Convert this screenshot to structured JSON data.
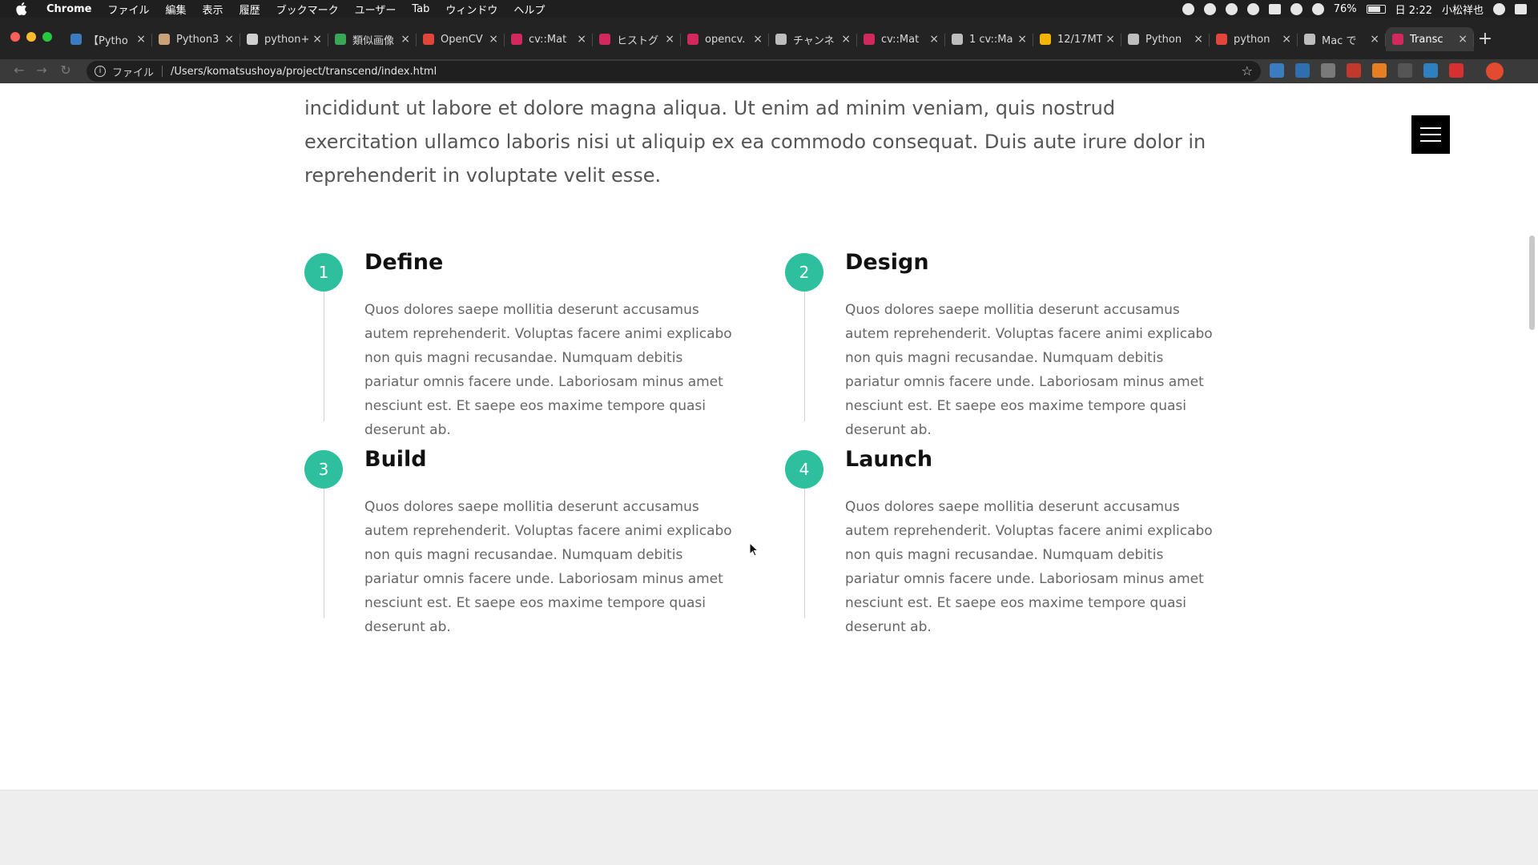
{
  "menubar": {
    "app": "Chrome",
    "items": [
      "ファイル",
      "編集",
      "表示",
      "履歴",
      "ブックマーク",
      "ユーザー",
      "Tab",
      "ウィンドウ",
      "ヘルプ"
    ],
    "battery": "76%",
    "battery_level": 0.76,
    "clock": "日 2:22",
    "user": "小松祥也"
  },
  "browser": {
    "tabs": [
      {
        "label": "【Pytho",
        "favicon_color": "#3b7bbf"
      },
      {
        "label": "Python3",
        "favicon_color": "#c9a27a"
      },
      {
        "label": "python+",
        "favicon_color": "#d0d0d0"
      },
      {
        "label": "類似画像",
        "favicon_color": "#3aa757"
      },
      {
        "label": "OpenCV",
        "favicon_color": "#e0463a"
      },
      {
        "label": "cv::Mat",
        "favicon_color": "#d1295b"
      },
      {
        "label": "ヒストグ",
        "favicon_color": "#d1295b"
      },
      {
        "label": "opencv.",
        "favicon_color": "#d1295b"
      },
      {
        "label": "チャンネ",
        "favicon_color": "#bdbdbd"
      },
      {
        "label": "cv::Mat",
        "favicon_color": "#d1295b"
      },
      {
        "label": "1 cv::Ma",
        "favicon_color": "#bdbdbd"
      },
      {
        "label": "12/17MT",
        "favicon_color": "#f2b400"
      },
      {
        "label": "Python",
        "favicon_color": "#bdbdbd"
      },
      {
        "label": "python",
        "favicon_color": "#e0463a"
      },
      {
        "label": "Mac で",
        "favicon_color": "#bdbdbd"
      },
      {
        "label": "Transc",
        "favicon_color": "#d1295b",
        "active": true
      }
    ],
    "scheme_label": "ファイル",
    "url": "/Users/komatsushoya/project/transcend/index.html"
  },
  "page": {
    "intro_text": "incididunt ut labore et dolore magna aliqua. Ut enim ad minim veniam, quis nostrud exercitation ullamco laboris nisi ut aliquip ex ea commodo consequat. Duis aute irure dolor in reprehenderit in voluptate velit esse.",
    "accent_color": "#2ebf9e",
    "steps": [
      {
        "number": "1",
        "title": "Define",
        "text": "Quos dolores saepe mollitia deserunt accusamus autem reprehenderit. Voluptas facere animi explicabo non quis magni recusandae. Numquam debitis pariatur omnis facere unde. Laboriosam minus amet nesciunt est. Et saepe eos maxime tempore quasi deserunt ab."
      },
      {
        "number": "2",
        "title": "Design",
        "text": "Quos dolores saepe mollitia deserunt accusamus autem reprehenderit. Voluptas facere animi explicabo non quis magni recusandae. Numquam debitis pariatur omnis facere unde. Laboriosam minus amet nesciunt est. Et saepe eos maxime tempore quasi deserunt ab."
      },
      {
        "number": "3",
        "title": "Build",
        "text": "Quos dolores saepe mollitia deserunt accusamus autem reprehenderit. Voluptas facere animi explicabo non quis magni recusandae. Numquam debitis pariatur omnis facere unde. Laboriosam minus amet nesciunt est. Et saepe eos maxime tempore quasi deserunt ab."
      },
      {
        "number": "4",
        "title": "Launch",
        "text": "Quos dolores saepe mollitia deserunt accusamus autem reprehenderit. Voluptas facere animi explicabo non quis magni recusandae. Numquam debitis pariatur omnis facere unde. Laboriosam minus amet nesciunt est. Et saepe eos maxime tempore quasi deserunt ab."
      }
    ]
  }
}
